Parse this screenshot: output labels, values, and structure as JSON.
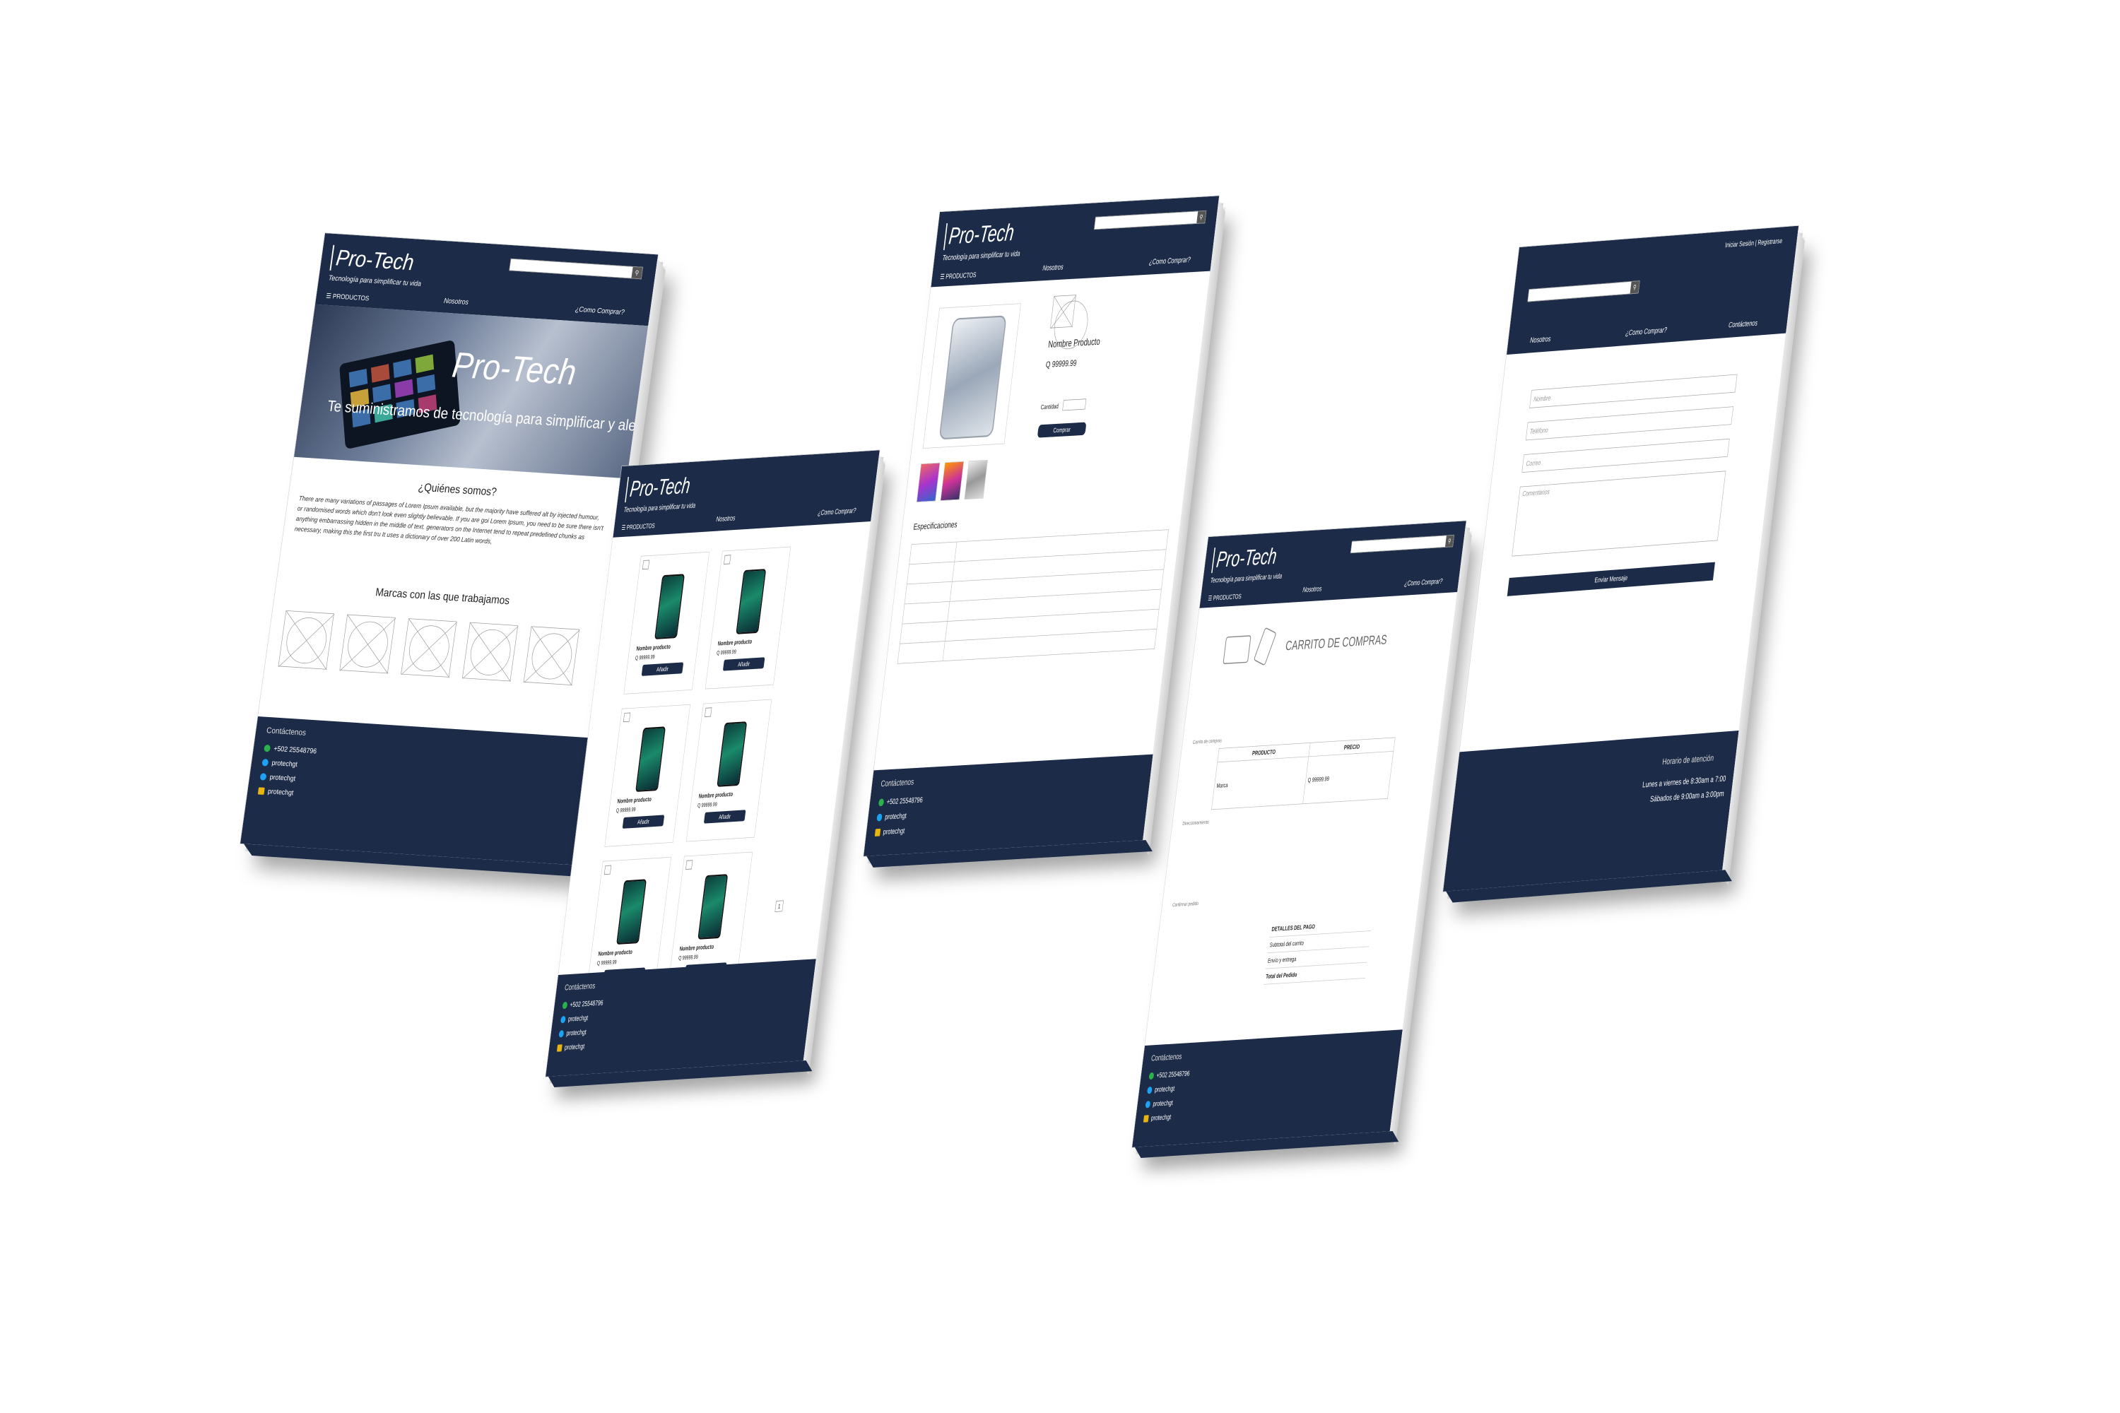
{
  "brand": {
    "name": "Pro-Tech",
    "tagline": "Tecnología para simplificar tu vida"
  },
  "nav": {
    "products": "PRODUCTOS",
    "about": "Nosotros",
    "how_to_buy": "¿Como Comprar?",
    "contact": "Contáctenos"
  },
  "auth": {
    "login": "Iniciar Sesión",
    "separator": "|",
    "register": "Registrarse"
  },
  "search": {
    "placeholder": "",
    "button_icon": "search-icon"
  },
  "home": {
    "hero_title": "Pro-Tech",
    "hero_subtitle": "Te suministramos de tecnología para simplificar y alegr",
    "about_title": "¿Quiénes somos?",
    "about_text": "There are many variations of passages of Lorem Ipsum available, but the majority have suffered alt by injected humour, or randomised words which don't look even slightly believable. If you are goi Lorem Ipsum, you need to be sure there isn't anything embarrassing hidden in the middle of text. generators on the Internet tend to repeat predefined chunks as necessary, making this the first tru It uses a dictionary of over 200 Latin words,",
    "brands_title": "Marcas con las que trabajamos"
  },
  "catalog": {
    "products": [
      {
        "name": "Nombre producto",
        "price": "Q 99999.99",
        "button": "Añadir"
      },
      {
        "name": "Nombre producto",
        "price": "Q 99999.99",
        "button": "Añadir"
      },
      {
        "name": "Nombre producto",
        "price": "Q 99999.99",
        "button": "Añadir"
      },
      {
        "name": "Nombre producto",
        "price": "Q 99999.99",
        "button": "Añadir"
      },
      {
        "name": "Nombre producto",
        "price": "Q 99999.99",
        "button": "Añadir"
      },
      {
        "name": "Nombre producto",
        "price": "Q 99999.99",
        "button": "Añadir"
      }
    ],
    "page": "1"
  },
  "product": {
    "name": "Nombre Producto",
    "price": "Q 99999.99",
    "qty_label": "Cantidad",
    "buy_button": "Comprar",
    "specs_title": "Especificaciones"
  },
  "cart": {
    "title": "CARRITO DE COMPRAS",
    "col_product": "PRODUCTO",
    "col_price": "PRECIO",
    "item_brand": "Marca",
    "item_price": "Q 99999.99",
    "steps": [
      "Carrito de compras",
      "Direccionamiento",
      "Confirmar pedido"
    ],
    "pay_title": "DETALLES DEL PAGO",
    "subtotal": "Subtotal del carrito",
    "shipping": "Envío y entrega",
    "total": "Total del Pedido"
  },
  "contact_form": {
    "name": "Nombre",
    "phone": "Teléfono",
    "email": "Correo",
    "comments": "Comentarios",
    "send": "Enviar Mensaje"
  },
  "footer": {
    "title": "Contáctenos",
    "phone": "+502 25548796",
    "whatsapp": "protechgt",
    "twitter": "protechgt",
    "email": "protechgt",
    "hours_title": "Horario de atención",
    "hours_week": "Lunes a viernes de 8:30am a 7:00",
    "hours_sat": "Sábados de 9:00am a 3:00pm"
  },
  "colors": {
    "navy": "#1c2b47",
    "white": "#ffffff",
    "whatsapp": "#2bb24c",
    "twitter": "#1da1f2",
    "email": "#e8b40f"
  }
}
